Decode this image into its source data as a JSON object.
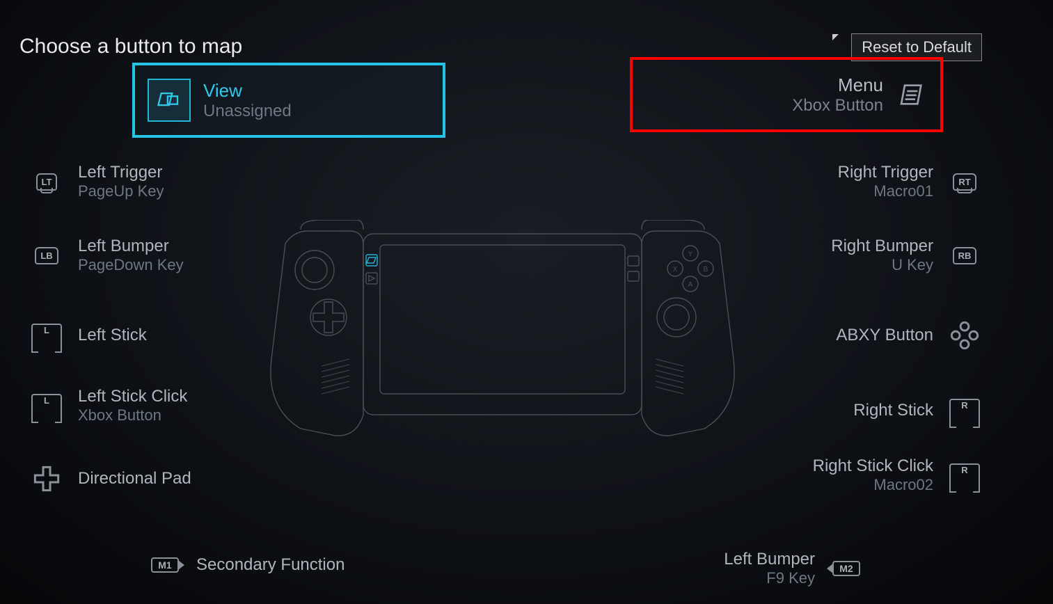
{
  "title": "Choose a button to map",
  "reset_label": "Reset to Default",
  "top": {
    "view": {
      "name": "View",
      "assignment": "Unassigned"
    },
    "menu": {
      "name": "Menu",
      "assignment": "Xbox Button"
    }
  },
  "left": {
    "lt": {
      "label": "Left Trigger",
      "sub": "PageUp Key",
      "badge": "LT"
    },
    "lb": {
      "label": "Left Bumper",
      "sub": "PageDown Key",
      "badge": "LB"
    },
    "ls": {
      "label": "Left Stick",
      "sub": "",
      "badge": "L"
    },
    "lsc": {
      "label": "Left Stick Click",
      "sub": "Xbox Button",
      "badge": "L"
    },
    "dpad": {
      "label": "Directional Pad",
      "sub": ""
    }
  },
  "right": {
    "rt": {
      "label": "Right Trigger",
      "sub": "Macro01",
      "badge": "RT"
    },
    "rb": {
      "label": "Right Bumper",
      "sub": "U Key",
      "badge": "RB"
    },
    "abxy": {
      "label": "ABXY Button",
      "sub": ""
    },
    "rs": {
      "label": "Right Stick",
      "sub": "",
      "badge": "R"
    },
    "rsc": {
      "label": "Right Stick Click",
      "sub": "Macro02",
      "badge": "R"
    }
  },
  "bottom": {
    "m1": {
      "label": "Secondary Function",
      "sub": "",
      "badge": "M1"
    },
    "m2": {
      "label": "Left Bumper",
      "sub": "F9 Key",
      "badge": "M2"
    }
  }
}
